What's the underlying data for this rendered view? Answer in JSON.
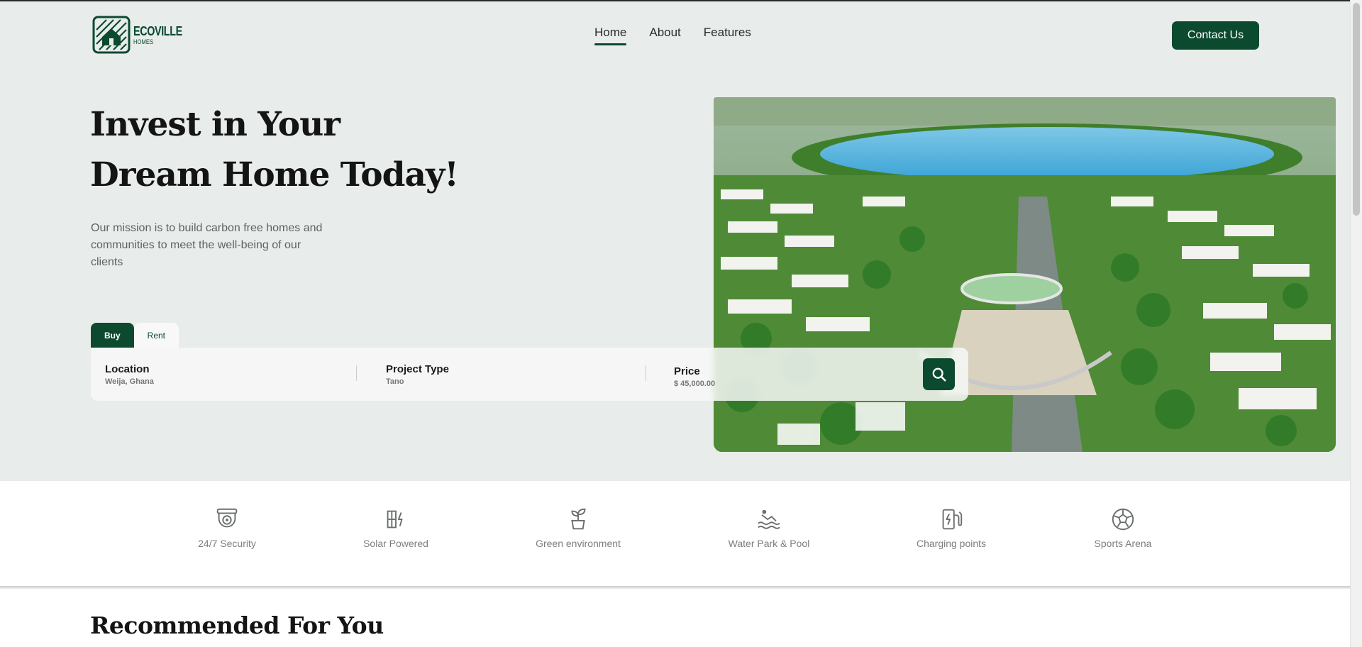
{
  "brand": {
    "name": "ECOVILLE",
    "sub": "HOMES",
    "color": "#0c4a30"
  },
  "nav": [
    {
      "label": "Home",
      "active": true
    },
    {
      "label": "About",
      "active": false
    },
    {
      "label": "Features",
      "active": false
    }
  ],
  "contact_label": "Contact Us",
  "hero": {
    "title_line1": "Invest in Your",
    "title_line2": "Dream Home Today!",
    "description": "Our mission is to build carbon free homes and communities to meet the well-being of our clients"
  },
  "search": {
    "tabs": [
      "Buy",
      "Rent"
    ],
    "active_tab": "Buy",
    "fields": [
      {
        "label": "Location",
        "value": "Weija, Ghana"
      },
      {
        "label": "Project Type",
        "value": "Tano"
      },
      {
        "label": "Price",
        "value": "$ 45,000.00"
      }
    ],
    "button_icon": "search-icon"
  },
  "features": [
    {
      "label": "24/7 Security",
      "icon": "security-camera-icon"
    },
    {
      "label": "Solar Powered",
      "icon": "solar-panel-icon"
    },
    {
      "label": "Green environment",
      "icon": "plant-icon"
    },
    {
      "label": "Water Park & Pool",
      "icon": "swimming-icon"
    },
    {
      "label": "Charging points",
      "icon": "charging-station-icon"
    },
    {
      "label": "Sports Arena",
      "icon": "soccer-ball-icon"
    }
  ],
  "section_title": "Recommended For You"
}
